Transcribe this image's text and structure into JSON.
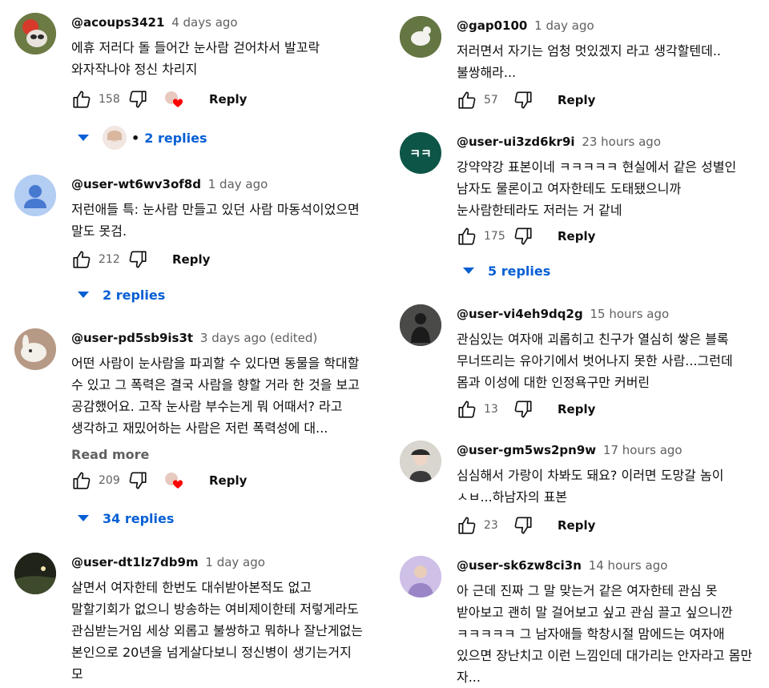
{
  "comments_left": [
    {
      "author": "@acoups3421",
      "time": "4 days ago",
      "text": "에휴 저러다 돌 들어간 눈사람 걷어차서 발꼬락 와자작나야 정신 차리지",
      "likes": "158",
      "reply_label": "Reply",
      "replies_label": "2 replies"
    },
    {
      "author": "@user-wt6wv3of8d",
      "time": "1 day ago",
      "text": "저런애들 특:  눈사람 만들고 있던 사람 마동석이었으면 말도 못검.",
      "likes": "212",
      "reply_label": "Reply",
      "replies_label": "2 replies"
    },
    {
      "author": "@user-pd5sb9is3t",
      "time": "3 days ago (edited)",
      "text": "어떤 사람이 눈사람을 파괴할 수 있다면 동물을 학대할 수 있고 그 폭력은 결국 사람을 향할 거라 한 것을 보고 공감했어요.  고작 눈사람 부수는게 뭐 어때서? 라고 생각하고 재밌어하는 사람은 저런 폭력성에 대...",
      "read_more": "Read more",
      "likes": "209",
      "reply_label": "Reply",
      "replies_label": "34 replies"
    },
    {
      "author": "@user-dt1lz7db9m",
      "time": "1 day ago",
      "text": "살면서 여자한테 한번도 대쉬받아본적도 없고 말할기회가 없으니 방송하는 여비제이한테 저렇게라도 관심받는거임 세상 외롭고 불쌍하고 뭐하나 잘난게없는 본인으로 20년을 넘게살다보니 정신병이 생기는거지 모"
    }
  ],
  "comments_right": [
    {
      "author": "@gap0100",
      "time": "1 day ago",
      "text": "저러면서 자기는 엄청 멋있겠지 라고 생각할텐데..불쌍해라...",
      "likes": "57",
      "reply_label": "Reply"
    },
    {
      "author": "@user-ui3zd6kr9i",
      "time": "23 hours ago",
      "avatar_text": "ㅋㅋ",
      "text": "강약약강 표본이네 ㅋㅋㅋㅋㅋ 현실에서 같은 성별인 남자도 물론이고 여자한테도 도태됐으니까 눈사람한테라도 저러는 거 같네",
      "likes": "175",
      "reply_label": "Reply",
      "replies_label": "5 replies"
    },
    {
      "author": "@user-vi4eh9dq2g",
      "time": "15 hours ago",
      "text": "관심있는 여자애 괴롭히고 친구가 열심히 쌓은 블록 무너뜨리는 유아기에서 벗어나지 못한 사람...그런데 몸과 이성에 대한 인정욕구만 커버린",
      "likes": "13",
      "reply_label": "Reply"
    },
    {
      "author": "@user-gm5ws2pn9w",
      "time": "17 hours ago",
      "text": "심심해서 가랑이 차봐도 돼요? 이러면 도망갈 놈이 ㅅㅂ...하남자의 표본",
      "likes": "23",
      "reply_label": "Reply"
    },
    {
      "author": "@user-sk6zw8ci3n",
      "time": "14 hours ago",
      "text": "아 근데 진짜 그 말 맞는거 같은 여자한테 관심 못 받아보고 괜히 말 걸어보고 싶고 관심 끌고 싶으니깐 ㅋㅋㅋㅋㅋ 그 남자애들 학창시절 맘에드는 여자애 있으면 장난치고 이런 느낌인데 대가리는 안자라고 몸만 자..."
    }
  ],
  "colors": {
    "link": "#065fd4",
    "secondary": "#606060",
    "heart": "#ff0000"
  }
}
